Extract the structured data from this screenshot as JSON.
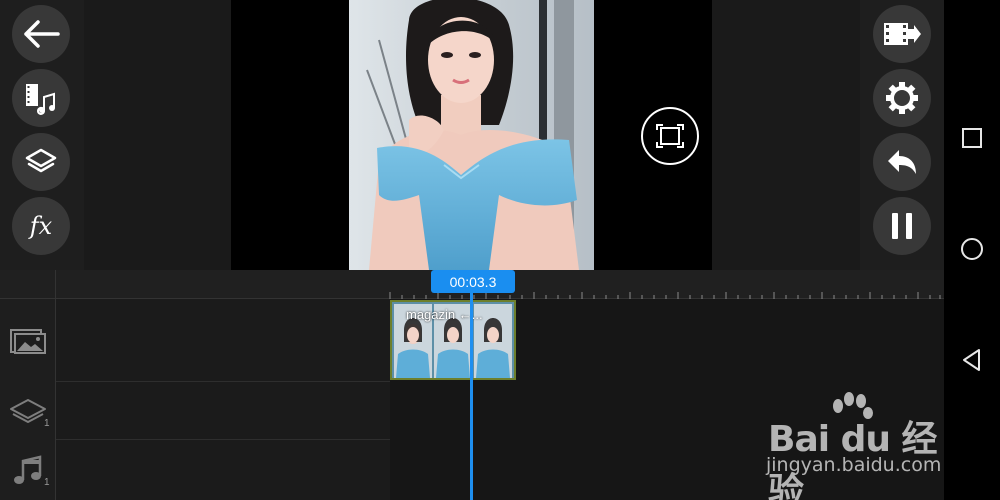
{
  "toolbar_left": {
    "buttons": [
      {
        "icon": "back-arrow-icon"
      },
      {
        "icon": "media-music-icon"
      },
      {
        "icon": "layers-icon"
      },
      {
        "icon": "fx-icon",
        "label": "fx"
      }
    ]
  },
  "toolbar_right": {
    "buttons": [
      {
        "icon": "export-icon"
      },
      {
        "icon": "settings-icon"
      },
      {
        "icon": "undo-icon"
      },
      {
        "icon": "pause-icon"
      }
    ]
  },
  "preview": {
    "fullscreen_icon": "fullscreen-icon"
  },
  "timeline": {
    "current_time": "00:03.3",
    "tracks": [
      {
        "name": "video",
        "icon": "image-track-icon"
      },
      {
        "name": "layer",
        "icon": "layer-track-icon",
        "count": "1"
      },
      {
        "name": "audio",
        "icon": "music-track-icon",
        "count": "1"
      }
    ],
    "clip": {
      "label": "magazin ←..."
    }
  },
  "android_nav": [
    "recents-icon",
    "home-icon",
    "back-icon"
  ],
  "watermark": {
    "brand": "Bai du 经验",
    "site": "jingyan.baidu.com"
  },
  "colors": {
    "accent": "#1a8ef0",
    "button_bg": "#383838",
    "clip_border": "#6d7f2c"
  }
}
